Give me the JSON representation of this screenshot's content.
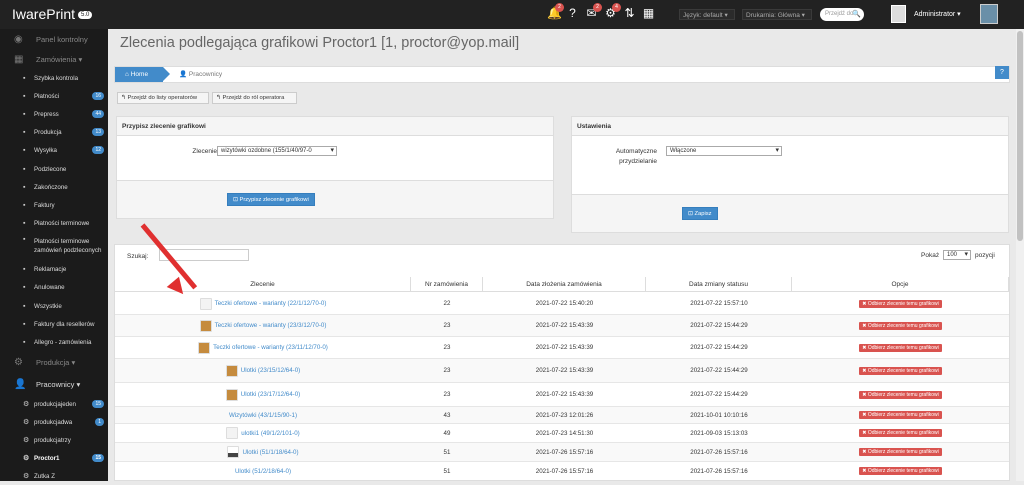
{
  "app": {
    "name": "IwarePrint",
    "version": "5.0"
  },
  "topbar": {
    "icons": [
      {
        "name": "bell-icon",
        "glyph": "🔔",
        "badge": "2"
      },
      {
        "name": "help-icon",
        "glyph": "?",
        "badge": ""
      },
      {
        "name": "mail-icon",
        "glyph": "✉",
        "badge": "2"
      },
      {
        "name": "gear-icon",
        "glyph": "⚙",
        "badge": "4"
      },
      {
        "name": "sort-icon",
        "glyph": "⇅",
        "badge": ""
      },
      {
        "name": "qr-icon",
        "glyph": "▦",
        "badge": ""
      }
    ],
    "language": "Język: default",
    "printer": "Drukarnia: Główna",
    "search_placeholder": "Przejdź do",
    "admin": "Administrator"
  },
  "sidebar": {
    "top_items": [
      {
        "label": "Panel kontrolny",
        "icon": "dashboard-icon"
      },
      {
        "label": "Zamówienia",
        "icon": "table-icon"
      }
    ],
    "items": [
      {
        "label": "Szybka kontrola",
        "badge": ""
      },
      {
        "label": "Płatności",
        "badge": "16"
      },
      {
        "label": "Prepress",
        "badge": "44"
      },
      {
        "label": "Produkcja",
        "badge": "13"
      },
      {
        "label": "Wysyłka",
        "badge": "12"
      },
      {
        "label": "Podzlecone",
        "badge": ""
      },
      {
        "label": "Zakończone",
        "badge": ""
      },
      {
        "label": "Faktury",
        "badge": ""
      },
      {
        "label": "Płatności terminowe",
        "badge": ""
      },
      {
        "label": "Płatności terminowe zamówień podzleconych",
        "badge": ""
      },
      {
        "label": "Reklamacje",
        "badge": ""
      },
      {
        "label": "Anulowane",
        "badge": ""
      },
      {
        "label": "Wszystkie",
        "badge": ""
      },
      {
        "label": "Faktury dla resellerów",
        "badge": ""
      },
      {
        "label": "Allegro - zamówienia",
        "badge": ""
      }
    ],
    "groups": [
      {
        "label": "Produkcja"
      },
      {
        "label": "Pracownicy"
      }
    ],
    "workers": [
      {
        "label": "produkcjajeden",
        "badge": "15"
      },
      {
        "label": "produkcjadwa",
        "badge": "1"
      },
      {
        "label": "produkcjatrzy",
        "badge": ""
      },
      {
        "label": "Proctor1",
        "badge": "15"
      },
      {
        "label": "Zutka Z",
        "badge": ""
      }
    ]
  },
  "page": {
    "title": "Zlecenia podlegająca grafikowi Proctor1 [1, proctor@yop.mail]",
    "breadcrumb": {
      "home": "Home",
      "current": "Pracownicy"
    },
    "buttons": {
      "back_operators": "Przejdź do listy operatorów",
      "back_roles": "Przejdź do ról operatora"
    }
  },
  "assign_panel": {
    "title": "Przypisz zlecenie grafikowi",
    "label": "Zlecenie",
    "select_value": "wizytówki ozdobne (155/1/40/97-0",
    "button": "Przypisz zlecenie grafikowi"
  },
  "settings_panel": {
    "title": "Ustawienia",
    "label": "Automatyczne przydzielanie",
    "select_value": "Włączone",
    "button": "Zapisz"
  },
  "table": {
    "search_label": "Szukaj:",
    "show_label": "Pokaż",
    "show_value": "100",
    "show_suffix": "pozycji",
    "headers": [
      "Zlecenie",
      "Nr zamówienia",
      "Data złożenia zamówienia",
      "Data zmiany statusu",
      "Opcje"
    ],
    "remove_label": "✖ Odbierz zlecenie temu grafikowi",
    "rows": [
      {
        "order": "Teczki ofertowe - warianty (22/1/12/70-0)",
        "nr": "22",
        "created": "2021-07-22 15:40:20",
        "changed": "2021-07-22 15:57:10",
        "thumb": "blank"
      },
      {
        "order": "Teczki ofertowe - warianty (23/3/12/70-0)",
        "nr": "23",
        "created": "2021-07-22 15:43:39",
        "changed": "2021-07-22 15:44:29",
        "thumb": "dog"
      },
      {
        "order": "Teczki ofertowe - warianty (23/11/12/70-0)",
        "nr": "23",
        "created": "2021-07-22 15:43:39",
        "changed": "2021-07-22 15:44:29",
        "thumb": "dog"
      },
      {
        "order": "Ulotki (23/15/12/64-0)",
        "nr": "23",
        "created": "2021-07-22 15:43:39",
        "changed": "2021-07-22 15:44:29",
        "thumb": "dog"
      },
      {
        "order": "Ulotki (23/17/12/64-0)",
        "nr": "23",
        "created": "2021-07-22 15:43:39",
        "changed": "2021-07-22 15:44:29",
        "thumb": "dog"
      },
      {
        "order": "Wizytówki (43/1/15/90-1)",
        "nr": "43",
        "created": "2021-07-23 12:01:26",
        "changed": "2021-10-01 10:10:16",
        "thumb": ""
      },
      {
        "order": "ulotki1 (49/1/2/101-0)",
        "nr": "49",
        "created": "2021-07-23 14:51:30",
        "changed": "2021-09-03 15:13:03",
        "thumb": "blank"
      },
      {
        "order": "Ulotki (51/1/18/64-0)",
        "nr": "51",
        "created": "2021-07-26 15:57:16",
        "changed": "2021-07-26 15:57:16",
        "thumb": "dark"
      },
      {
        "order": "Ulotki (51/2/18/64-0)",
        "nr": "51",
        "created": "2021-07-26 15:57:16",
        "changed": "2021-07-26 15:57:16",
        "thumb": ""
      }
    ]
  }
}
